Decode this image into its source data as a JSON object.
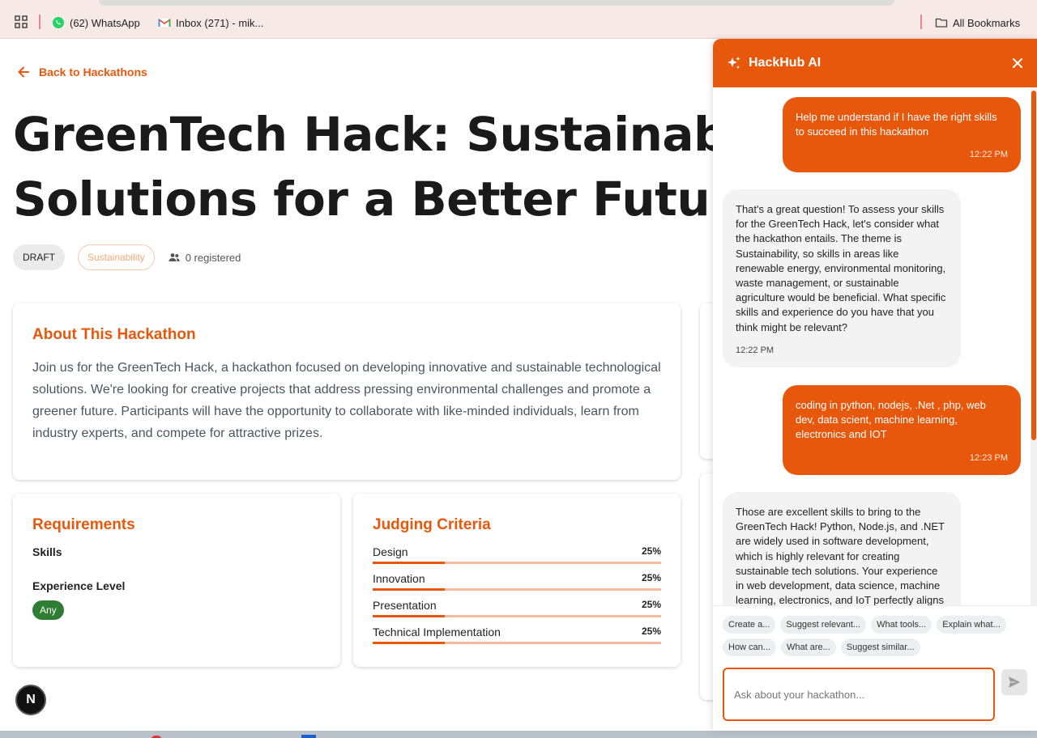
{
  "browser": {
    "bookmarks": [
      {
        "label": "(62) WhatsApp",
        "icon": "whatsapp-icon"
      },
      {
        "label": "Inbox (271) - mik...",
        "icon": "gmail-icon"
      }
    ],
    "all_bookmarks": "All Bookmarks"
  },
  "page": {
    "back_label": "Back to Hackathons",
    "title_line1": "GreenTech Hack: Sustainable",
    "title_line2": "Solutions for a Better Future",
    "status_badge": "DRAFT",
    "category_badge": "Sustainability",
    "registered": "0 registered"
  },
  "about": {
    "heading": "About This Hackathon",
    "text": "Join us for the GreenTech Hack, a hackathon focused on developing innovative and sustainable technological solutions. We're looking for creative projects that address pressing environmental challenges and promote a greener future. Participants will have the opportunity to collaborate with like-minded individuals, learn from industry experts, and compete for attractive prizes."
  },
  "requirements": {
    "heading": "Requirements",
    "skills_label": "Skills",
    "experience_label": "Experience Level",
    "experience_value": "Any"
  },
  "judging": {
    "heading": "Judging Criteria",
    "criteria": [
      {
        "name": "Design",
        "percent": "25%",
        "fraction": 0.25
      },
      {
        "name": "Innovation",
        "percent": "25%",
        "fraction": 0.25
      },
      {
        "name": "Presentation",
        "percent": "25%",
        "fraction": 0.25
      },
      {
        "name": "Technical Implementation",
        "percent": "25%",
        "fraction": 0.25
      }
    ]
  },
  "chat": {
    "title": "HackHub AI",
    "messages": [
      {
        "role": "user",
        "text": "Help me understand if I have the right skills to succeed in this hackathon",
        "time": "12:22 PM"
      },
      {
        "role": "ai",
        "text": "That's a great question!  To assess your skills for the GreenTech Hack, let's consider what the hackathon entails.  The theme is Sustainability, so skills in areas like renewable energy, environmental monitoring, waste management, or sustainable agriculture would be beneficial.  What specific skills and experience do you have that you think might be relevant?",
        "time": "12:22 PM"
      },
      {
        "role": "user",
        "text": "coding in python, nodejs, .Net , php, web dev, data scient, machine learning, electronics and IOT",
        "time": "12:23 PM"
      },
      {
        "role": "ai",
        "text": "Those are excellent skills to bring to the GreenTech Hack!  Python, Node.js, and .NET are widely used in software development, which is highly relevant for creating sustainable tech solutions. Your experience in web development, data science, machine learning, electronics, and IoT perfectly aligns",
        "time": ""
      }
    ],
    "suggestions": [
      "Create a...",
      "Suggest relevant...",
      "What tools...",
      "Explain what...",
      "How can...",
      "What are...",
      "Suggest similar..."
    ],
    "input_placeholder": "Ask about your hackathon..."
  },
  "colors": {
    "accent": "#e8580c",
    "success": "#2e7d32"
  }
}
